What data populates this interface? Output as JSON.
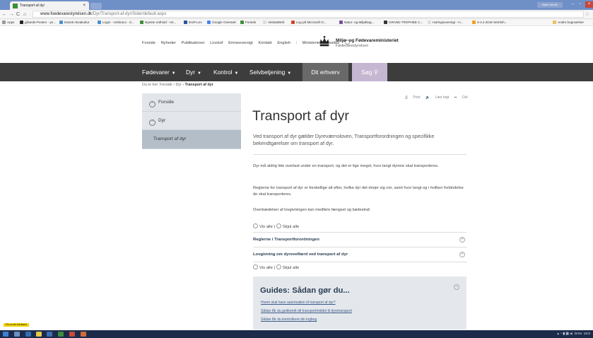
{
  "browser": {
    "tab_title": "Transport af dyr",
    "tab_close": "×",
    "user_badge": "Niels Henrik",
    "url_domain": "www.foedevarestyrelsen.dk",
    "url_path": "/Dyr/Transport-af-dyr/Sider/default.aspx",
    "bookmarks": [
      "Apps",
      "jyllands-Posten - ye...",
      "Dansk Akvakultur",
      "Login - Umbraco - d...",
      "Nyeste redhold - ret...",
      "EUR-Lex",
      "Google Oversæt",
      "Forside",
      "VetstatWeb",
      "Log på Microsoft O...",
      "Natur- og Miljøklag...",
      "GRAND TROPHEE C...",
      "Høringsoversigt - H...",
      "3-4.2.2015 Worksh...",
      "Andre bogmærker"
    ]
  },
  "site": {
    "top_links": [
      "Forside",
      "Nyheder",
      "Publikationer",
      "Lovstof",
      "Emneoversigt",
      "Kontakt",
      "English"
    ],
    "ministries_link": "Ministeriets websites",
    "ministry_name": "Miljø- og Fødevareministeriet",
    "agency_name": "Fødevarestyrelsen",
    "main_nav": [
      "Fødevarer",
      "Dyr",
      "Kontrol",
      "Selvbetjening"
    ],
    "main_nav_erhverv": "Dit erhverv",
    "main_nav_search": "Søg"
  },
  "breadcrumb": {
    "prefix": "Du er her:",
    "items": [
      "Forside",
      "Dyr"
    ],
    "current": "Transport af dyr",
    "sep": "›"
  },
  "sidebar": {
    "items": [
      "Forside",
      "Dyr"
    ],
    "active": "Transport af dyr"
  },
  "tools": {
    "print": "Print",
    "read": "Læs højt",
    "share": "Del"
  },
  "article": {
    "title": "Transport af dyr",
    "lead": "Ved transport af dyr gælder Dyreværnsloven, Transportforordningen og specifikke bekendtgørelser om transport af dyr.",
    "p1": "Dyr må aldrig lide overlast under en transport, og det er lige meget, hvor langt dyrene skal transporteres.",
    "p2": "Reglerne for transport af dyr er forskellige alt efter, hvilke dyr det drejer sig om, samt hvor langt og i hvilken forbindelse de skal transporteres.",
    "p3": "Overtrædelser af lovgivningen kan medføre fængsel og bødestraf.",
    "show_all": "Vis alle",
    "hide_all": "Skjul alle",
    "toggle_sep": "|",
    "accordion": [
      "Reglerne i Transportforordningen",
      "Lovgivning om dyrevelfærd ved transport af dyr"
    ]
  },
  "guides": {
    "title": "Guides: Sådan gør du...",
    "links": [
      "Hvem skal have autorisation til transport af dyr?",
      "Sådan får du godkendt dit transportmiddel til dyretransport",
      "Sådan får du kontrolleret din logbog"
    ]
  },
  "feedback": "Giv os din feedback",
  "taskbar": {
    "lang": "DAN",
    "time": "15:0"
  },
  "colors": {
    "main_nav_bg": "#3d3d3d",
    "search_bg": "#c5b7d2",
    "sidebar_active": "#b4bec8",
    "guides_bg": "#e4e8ec"
  }
}
